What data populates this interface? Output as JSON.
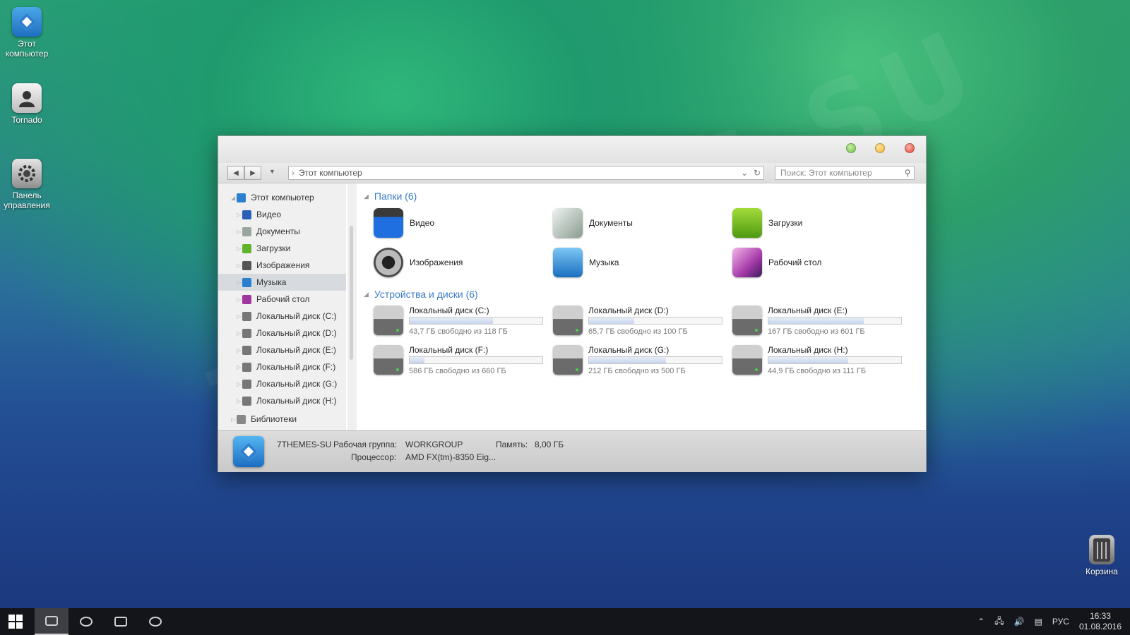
{
  "desktop": {
    "icons": [
      {
        "label": "Этот компьютер"
      },
      {
        "label": "Tornado"
      },
      {
        "label": "Панель управления"
      },
      {
        "label": "Корзина"
      }
    ],
    "watermark": "7THEMES.SU"
  },
  "window": {
    "address": "Этот компьютер",
    "search_placeholder": "Поиск: Этот компьютер",
    "sidebar": {
      "root": "Этот компьютер",
      "items": [
        {
          "label": "Видео",
          "color": "#2c5fb8"
        },
        {
          "label": "Документы",
          "color": "#9aa79e"
        },
        {
          "label": "Загрузки",
          "color": "#63b32a"
        },
        {
          "label": "Изображения",
          "color": "#555555"
        },
        {
          "label": "Музыка",
          "color": "#2a7fd0"
        },
        {
          "label": "Рабочий стол",
          "color": "#a0369e"
        },
        {
          "label": "Локальный диск (C:)",
          "color": "#777777"
        },
        {
          "label": "Локальный диск (D:)",
          "color": "#777777"
        },
        {
          "label": "Локальный диск (E:)",
          "color": "#777777"
        },
        {
          "label": "Локальный диск (F:)",
          "color": "#777777"
        },
        {
          "label": "Локальный диск (G:)",
          "color": "#777777"
        },
        {
          "label": "Локальный диск (H:)",
          "color": "#777777"
        }
      ],
      "libraries": "Библиотеки"
    },
    "folders_header": "Папки (6)",
    "folders": [
      {
        "label": "Видео",
        "icon": "video-icon"
      },
      {
        "label": "Документы",
        "icon": "documents-icon"
      },
      {
        "label": "Загрузки",
        "icon": "downloads-icon"
      },
      {
        "label": "Изображения",
        "icon": "images-icon"
      },
      {
        "label": "Музыка",
        "icon": "music-icon"
      },
      {
        "label": "Рабочий стол",
        "icon": "desktop-folder-icon"
      }
    ],
    "drives_header": "Устройства и диски (6)",
    "drives": [
      {
        "name": "Локальный диск (C:)",
        "free": "43,7 ГБ свободно из 118 ГБ",
        "used_fraction": 0.63
      },
      {
        "name": "Локальный диск (D:)",
        "free": "65,7 ГБ свободно из 100 ГБ",
        "used_fraction": 0.34
      },
      {
        "name": "Локальный диск (E:)",
        "free": "167 ГБ свободно из 601 ГБ",
        "used_fraction": 0.72
      },
      {
        "name": "Локальный диск (F:)",
        "free": "586 ГБ свободно из 660 ГБ",
        "used_fraction": 0.11
      },
      {
        "name": "Локальный диск (G:)",
        "free": "212 ГБ свободно из 500 ГБ",
        "used_fraction": 0.58
      },
      {
        "name": "Локальный диск (H:)",
        "free": "44,9 ГБ свободно из 111 ГБ",
        "used_fraction": 0.6
      }
    ],
    "details": {
      "computer_name": "7THEMES-SU",
      "workgroup_label": "Рабочая группа:",
      "workgroup": "WORKGROUP",
      "memory_label": "Память:",
      "memory": "8,00 ГБ",
      "cpu_label": "Процессор:",
      "cpu": "AMD FX(tm)-8350 Eig..."
    }
  },
  "taskbar": {
    "language": "РУС",
    "time": "16:33",
    "date": "01.08.2016"
  }
}
